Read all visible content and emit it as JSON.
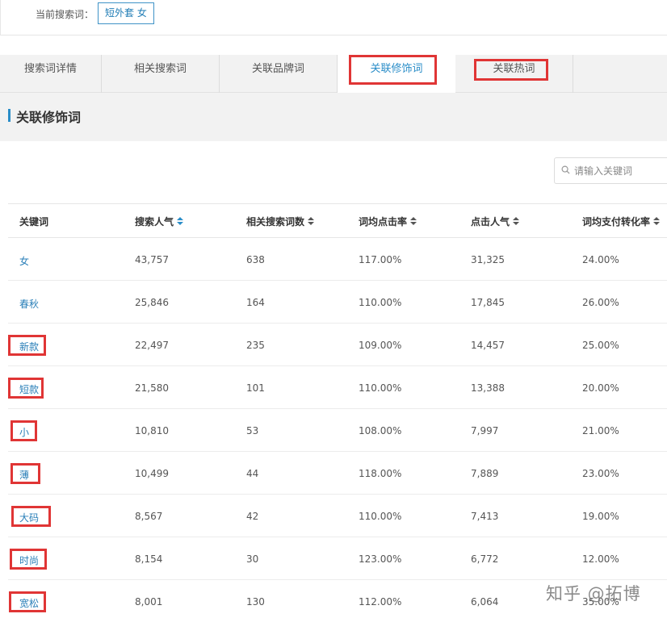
{
  "search_bar": {
    "label": "当前搜索词：",
    "current_term": "短外套 女"
  },
  "tabs": [
    {
      "label": "搜索词详情",
      "active": false
    },
    {
      "label": "相关搜索词",
      "active": false
    },
    {
      "label": "关联品牌词",
      "active": false
    },
    {
      "label": "关联修饰词",
      "active": true
    },
    {
      "label": "关联热词",
      "active": false
    }
  ],
  "section": {
    "title": "关联修饰词"
  },
  "filter": {
    "placeholder": "请输入关键词"
  },
  "table": {
    "columns": [
      "关键词",
      "搜索人气",
      "相关搜索词数",
      "词均点击率",
      "点击人气",
      "词均支付转化率"
    ],
    "rows": [
      [
        "女",
        "43,757",
        "638",
        "117.00%",
        "31,325",
        "24.00%"
      ],
      [
        "春秋",
        "25,846",
        "164",
        "110.00%",
        "17,845",
        "26.00%"
      ],
      [
        "新款",
        "22,497",
        "235",
        "109.00%",
        "14,457",
        "25.00%"
      ],
      [
        "短款",
        "21,580",
        "101",
        "110.00%",
        "13,388",
        "20.00%"
      ],
      [
        "小",
        "10,810",
        "53",
        "108.00%",
        "7,997",
        "21.00%"
      ],
      [
        "薄",
        "10,499",
        "44",
        "118.00%",
        "7,889",
        "23.00%"
      ],
      [
        "大码",
        "8,567",
        "42",
        "110.00%",
        "7,413",
        "19.00%"
      ],
      [
        "时尚",
        "8,154",
        "30",
        "123.00%",
        "6,772",
        "12.00%"
      ],
      [
        "宽松",
        "8,001",
        "130",
        "112.00%",
        "6,064",
        "35.00%"
      ]
    ]
  },
  "watermark": "知乎 @拓博",
  "colors": {
    "accent": "#2a8dc8",
    "highlight": "#e03535",
    "tab_bg": "#f2f2f2"
  }
}
